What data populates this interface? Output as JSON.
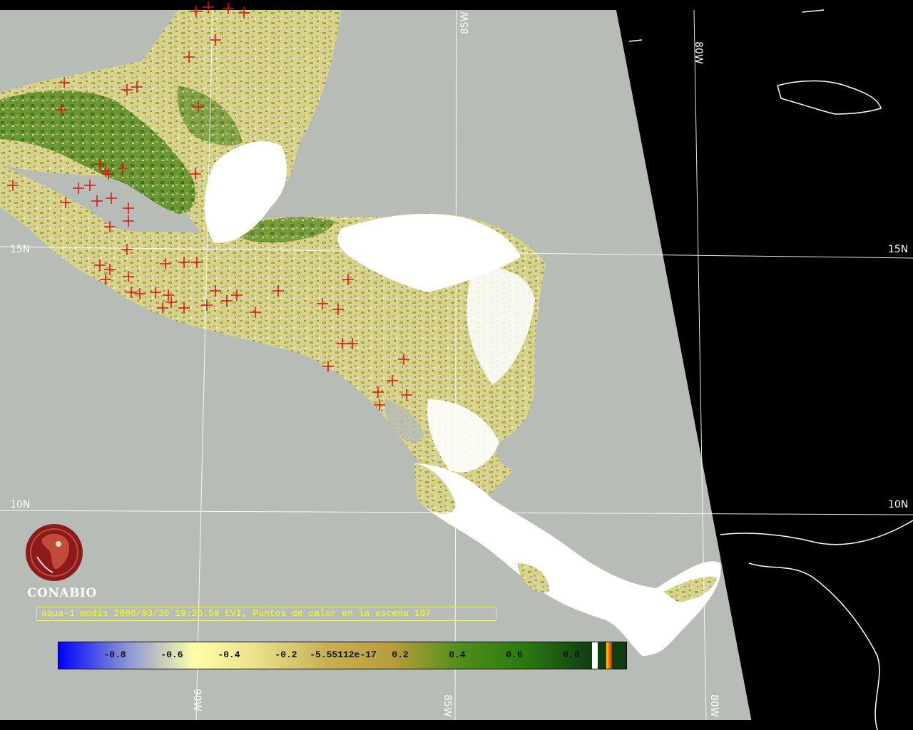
{
  "map": {
    "lat_labels": [
      {
        "text": "15N",
        "lat": 15
      },
      {
        "text": "10N",
        "lat": 10
      }
    ],
    "lon_labels_top": [
      {
        "text": "85W",
        "lon": -85
      },
      {
        "text": "80W",
        "lon": -80
      }
    ],
    "lon_labels_bottom": [
      {
        "text": "90W",
        "lon": -90
      },
      {
        "text": "85W",
        "lon": -85
      },
      {
        "text": "80W",
        "lon": -80
      }
    ],
    "colors": {
      "background_outside_swath": "#000000",
      "ocean": "#b7bcb6",
      "cloud": "#ffffff",
      "hotspot": "#dd1111",
      "graticule": "#ffffff"
    },
    "hotspot_marker": "red-cross"
  },
  "logo": {
    "name": "CONABIO",
    "icon": "conabio-macaw-logo",
    "color": "#8b1a1a"
  },
  "caption": {
    "text": "aqua-1 modis 2006/03/30 19:26:50 EVI, Puntos de calor en la escena 107"
  },
  "colorbar": {
    "ticks": [
      "-0.8",
      "-0.6",
      "-0.4",
      "-0.2",
      "-5.55112e-17",
      "0.2",
      "0.4",
      "0.6",
      "0.8"
    ],
    "colors": [
      "#0000ff",
      "#8a94d4",
      "#ffffa8",
      "#e8e08a",
      "#c8b255",
      "#b89c3a",
      "#4e8e1a",
      "#2a7a10",
      "#0e3e0e"
    ]
  }
}
